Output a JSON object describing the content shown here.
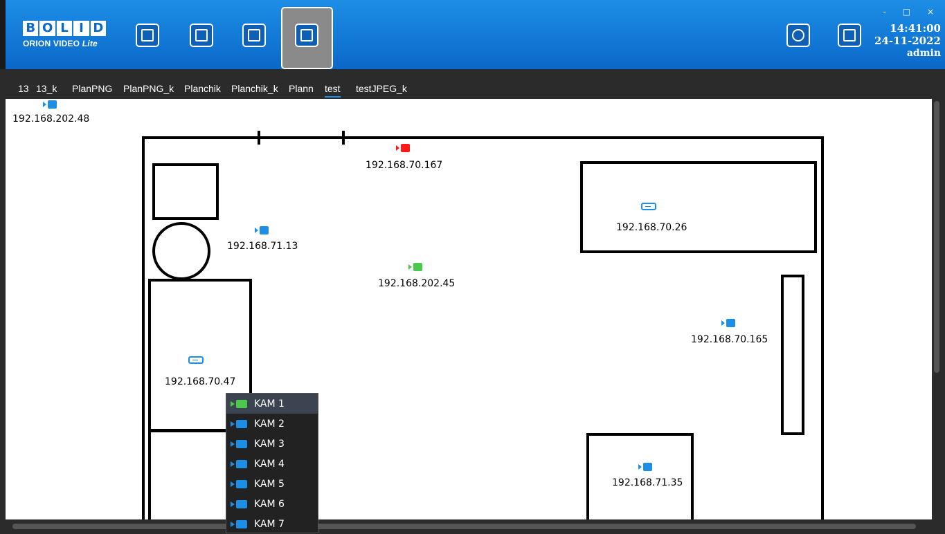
{
  "header": {
    "logo_main": "BOLID",
    "logo_sub": "ORION VIDEO",
    "logo_sub_italic": "Lite",
    "time": "14:41:00",
    "date": "24-11-2022",
    "user": "admin",
    "window_controls": "- □ ×",
    "tools": [
      "camera-view-icon",
      "clapperboard-icon",
      "document-search-icon",
      "floor-plan-icon"
    ],
    "settings_icon": "gear-icon",
    "add_window_icon": "add-window-icon"
  },
  "tabs": [
    "13",
    "13_k",
    "PlanPNG",
    "PlanPNG_k",
    "Planchik",
    "Planchik_k",
    "Plann",
    "test",
    "testJPEG_k"
  ],
  "active_tab": "test",
  "plan": {
    "cameras": [
      {
        "label": "192.168.202.48",
        "color": "#1d8ee6"
      },
      {
        "label": "192.168.70.167",
        "color": "#ff1a1a"
      },
      {
        "label": "192.168.71.13",
        "color": "#1d8ee6"
      },
      {
        "label": "192.168.202.45",
        "color": "#4cc84c"
      },
      {
        "label": "192.168.70.165",
        "color": "#1d8ee6"
      },
      {
        "label": "192.168.71.35",
        "color": "#1d8ee6"
      }
    ],
    "recorders": [
      {
        "label": "192.168.70.26"
      },
      {
        "label": "192.168.70.47"
      }
    ]
  },
  "context_menu": {
    "items": [
      {
        "label": "KAM 1",
        "color": "#4cc84c"
      },
      {
        "label": "KAM 2",
        "color": "#1d8ee6"
      },
      {
        "label": "KAM 3",
        "color": "#1d8ee6"
      },
      {
        "label": "KAM 4",
        "color": "#1d8ee6"
      },
      {
        "label": "KAM 5",
        "color": "#1d8ee6"
      },
      {
        "label": "KAM 6",
        "color": "#1d8ee6"
      },
      {
        "label": "KAM 7",
        "color": "#1d8ee6"
      }
    ]
  }
}
